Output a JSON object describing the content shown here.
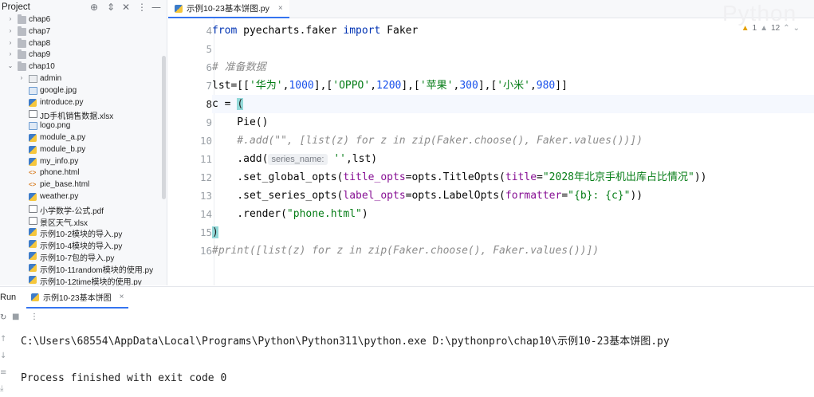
{
  "project": {
    "title": "Project",
    "tree": [
      {
        "label": "chap6",
        "type": "folder",
        "depth": 1,
        "expanded": false
      },
      {
        "label": "chap7",
        "type": "folder",
        "depth": 1,
        "expanded": false
      },
      {
        "label": "chap8",
        "type": "folder",
        "depth": 1,
        "expanded": false
      },
      {
        "label": "chap9",
        "type": "folder",
        "depth": 1,
        "expanded": false
      },
      {
        "label": "chap10",
        "type": "folder",
        "depth": 1,
        "expanded": true
      },
      {
        "label": "admin",
        "type": "dir",
        "depth": 2,
        "expanded": false
      },
      {
        "label": "google.jpg",
        "type": "img",
        "depth": 2
      },
      {
        "label": "introduce.py",
        "type": "py",
        "depth": 2
      },
      {
        "label": "JD手机销售数据.xlsx",
        "type": "xls",
        "depth": 2
      },
      {
        "label": "logo.png",
        "type": "img",
        "depth": 2
      },
      {
        "label": "module_a.py",
        "type": "py",
        "depth": 2
      },
      {
        "label": "module_b.py",
        "type": "py",
        "depth": 2
      },
      {
        "label": "my_info.py",
        "type": "py",
        "depth": 2
      },
      {
        "label": "phone.html",
        "type": "html",
        "depth": 2
      },
      {
        "label": "pie_base.html",
        "type": "html",
        "depth": 2
      },
      {
        "label": "weather.py",
        "type": "py",
        "depth": 2
      },
      {
        "label": "小学数学-公式.pdf",
        "type": "pdf",
        "depth": 2
      },
      {
        "label": "景区天气.xlsx",
        "type": "xls",
        "depth": 2
      },
      {
        "label": "示例10-2模块的导入.py",
        "type": "py",
        "depth": 2
      },
      {
        "label": "示例10-4模块的导入.py",
        "type": "py",
        "depth": 2
      },
      {
        "label": "示例10-7包的导入.py",
        "type": "py",
        "depth": 2
      },
      {
        "label": "示例10-11random模块的使用.py",
        "type": "py",
        "depth": 2
      },
      {
        "label": "示例10-12time模块的使用.py",
        "type": "py",
        "depth": 2
      }
    ]
  },
  "editor": {
    "tab_label": "示例10-23基本饼图.py",
    "watermark": "Python",
    "inspection": {
      "warnings": "1",
      "weak_warnings": "12"
    },
    "lines": [
      {
        "num": "4",
        "tokens": [
          {
            "t": "from ",
            "c": "kw"
          },
          {
            "t": "pyecharts.faker ",
            "c": "plain"
          },
          {
            "t": "import ",
            "c": "kw"
          },
          {
            "t": "Faker",
            "c": "plain"
          }
        ]
      },
      {
        "num": "5",
        "tokens": []
      },
      {
        "num": "6",
        "tokens": [
          {
            "t": "# 准备数据",
            "c": "cm"
          }
        ]
      },
      {
        "num": "7",
        "tokens": [
          {
            "t": "lst=[[",
            "c": "plain"
          },
          {
            "t": "'华为'",
            "c": "str"
          },
          {
            "t": ",",
            "c": "plain"
          },
          {
            "t": "1000",
            "c": "num"
          },
          {
            "t": "],[",
            "c": "plain"
          },
          {
            "t": "'OPPO'",
            "c": "str"
          },
          {
            "t": ",",
            "c": "plain"
          },
          {
            "t": "1200",
            "c": "num"
          },
          {
            "t": "],[",
            "c": "plain"
          },
          {
            "t": "'苹果'",
            "c": "str"
          },
          {
            "t": ",",
            "c": "plain"
          },
          {
            "t": "300",
            "c": "num"
          },
          {
            "t": "],[",
            "c": "plain"
          },
          {
            "t": "'小米'",
            "c": "str"
          },
          {
            "t": ",",
            "c": "plain"
          },
          {
            "t": "980",
            "c": "num"
          },
          {
            "t": "]]",
            "c": "plain"
          }
        ]
      },
      {
        "num": "8",
        "current": true,
        "tokens": [
          {
            "t": "c = ",
            "c": "plain"
          },
          {
            "t": "(",
            "c": "paren-m"
          }
        ]
      },
      {
        "num": "9",
        "tokens": [
          {
            "t": "    Pie()",
            "c": "plain"
          }
        ]
      },
      {
        "num": "10",
        "tokens": [
          {
            "t": "    #.add(\"\", [list(z) for z in zip(Faker.choose(), Faker.values())])",
            "c": "cm"
          }
        ]
      },
      {
        "num": "11",
        "tokens": [
          {
            "t": "    .add(",
            "c": "plain"
          },
          {
            "t": "series_name:",
            "c": "hint"
          },
          {
            "t": " ",
            "c": "plain"
          },
          {
            "t": "''",
            "c": "str"
          },
          {
            "t": ",lst)",
            "c": "plain"
          }
        ]
      },
      {
        "num": "12",
        "tokens": [
          {
            "t": "    .set_global_opts(",
            "c": "plain"
          },
          {
            "t": "title_opts",
            "c": "par"
          },
          {
            "t": "=opts.TitleOpts(",
            "c": "plain"
          },
          {
            "t": "title",
            "c": "par"
          },
          {
            "t": "=",
            "c": "plain"
          },
          {
            "t": "\"2028年北京手机出库占比情况\"",
            "c": "str"
          },
          {
            "t": "))",
            "c": "plain"
          }
        ]
      },
      {
        "num": "13",
        "tokens": [
          {
            "t": "    .set_series_opts(",
            "c": "plain"
          },
          {
            "t": "label_opts",
            "c": "par"
          },
          {
            "t": "=opts.LabelOpts(",
            "c": "plain"
          },
          {
            "t": "formatter",
            "c": "par"
          },
          {
            "t": "=",
            "c": "plain"
          },
          {
            "t": "\"{b}: {c}\"",
            "c": "str"
          },
          {
            "t": "))",
            "c": "plain"
          }
        ]
      },
      {
        "num": "14",
        "tokens": [
          {
            "t": "    .render(",
            "c": "plain"
          },
          {
            "t": "\"phone.html\"",
            "c": "str"
          },
          {
            "t": ")",
            "c": "plain"
          }
        ]
      },
      {
        "num": "15",
        "tokens": [
          {
            "t": ")",
            "c": "paren-m"
          }
        ]
      },
      {
        "num": "16",
        "tokens": [
          {
            "t": "#print([list(z) for z in zip(Faker.choose(), Faker.values())])",
            "c": "cm"
          }
        ]
      }
    ]
  },
  "run": {
    "title": "Run",
    "tab_label": "示例10-23基本饼图",
    "console": [
      "C:\\Users\\68554\\AppData\\Local\\Programs\\Python\\Python311\\python.exe D:\\pythonpro\\chap10\\示例10-23基本饼图.py",
      "",
      "Process finished with exit code 0"
    ]
  }
}
